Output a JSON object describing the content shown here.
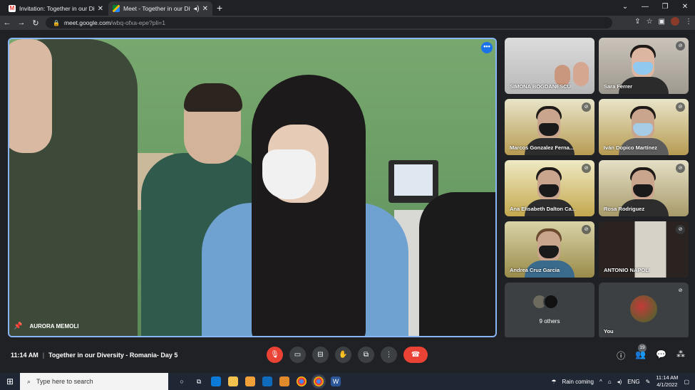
{
  "browser": {
    "tabs": [
      {
        "title": "Invitation: Together in our Divers",
        "active": false,
        "icon": "gmail-icon"
      },
      {
        "title": "Meet - Together in our Divers",
        "active": true,
        "icon": "meet-icon"
      }
    ],
    "url_domain": "meet.google.com",
    "url_path": "/wbq-ofxa-epe?pli=1"
  },
  "main_tile": {
    "name": "AURORA MEMOLI",
    "more_icon": "more-icon",
    "pin_icon": "pin-icon"
  },
  "participants": [
    {
      "name": "SIMONA BOGDANESCU",
      "muted": false
    },
    {
      "name": "Sara Ferrer",
      "muted": true
    },
    {
      "name": "Marcos Gonzalez Ferna...",
      "muted": true
    },
    {
      "name": "Iván Dopico Martínez",
      "muted": true
    },
    {
      "name": "Ana Elisabeth Dalton Ca...",
      "muted": true
    },
    {
      "name": "Rosa Rodriguez",
      "muted": true
    },
    {
      "name": "Andrea Cruz Garcia",
      "muted": true
    },
    {
      "name": "ANTONIO NAPOLI",
      "muted": true
    }
  ],
  "others": {
    "label": "9 others"
  },
  "you": {
    "label": "You"
  },
  "bottom": {
    "time": "11:14 AM",
    "separator": "|",
    "meeting_title": "Together in our Diversity - Romania- Day 5",
    "people_count": "19"
  },
  "taskbar": {
    "search_placeholder": "Type here to search",
    "weather": "Rain coming",
    "lang": "ENG",
    "clock_time": "11:14 AM",
    "clock_date": "4/1/2022"
  },
  "colors": {
    "accent": "#8ab4f8",
    "mic_off": "#ea4335",
    "end_call": "#ea4335"
  }
}
